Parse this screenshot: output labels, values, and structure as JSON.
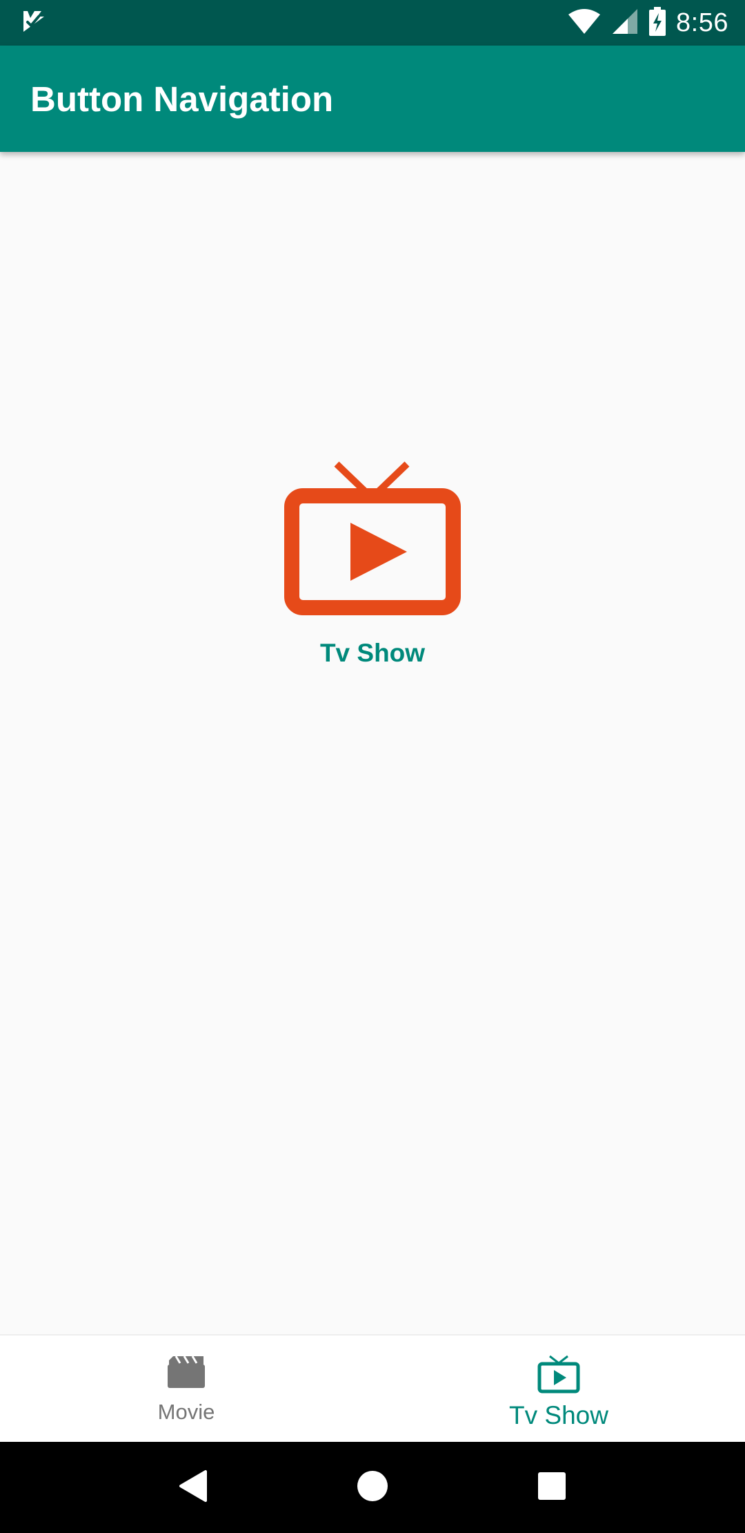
{
  "status_bar": {
    "time": "8:56",
    "icons": [
      "app-notification-icon",
      "wifi-icon",
      "signal-icon",
      "battery-charging-icon"
    ]
  },
  "app_bar": {
    "title": "Button Navigation"
  },
  "main": {
    "icon": "tv-play-icon",
    "label": "Tv Show",
    "colors": {
      "icon": "#e64a19",
      "label": "#00897b"
    }
  },
  "bottom_nav": {
    "items": [
      {
        "label": "Movie",
        "icon": "movie-clapper-icon",
        "active": false
      },
      {
        "label": "Tv Show",
        "icon": "tv-icon",
        "active": true
      }
    ],
    "colors": {
      "active": "#00897b",
      "inactive": "#757575"
    }
  },
  "system_nav": {
    "buttons": [
      "back-icon",
      "home-icon",
      "recents-icon"
    ]
  },
  "theme": {
    "primary": "#00897b",
    "primary_dark": "#00574f",
    "background": "#fafafa"
  }
}
